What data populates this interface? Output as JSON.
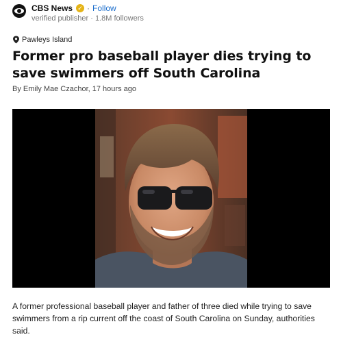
{
  "publisher": {
    "name": "CBS News",
    "verified_label": "verified publisher",
    "followers": "1.8M followers",
    "follow_label": "Follow",
    "logo_icon": "cbs-eye-icon",
    "verified_icon": "verified-check-icon"
  },
  "article": {
    "location": "Pawleys Island",
    "location_icon": "map-pin-icon",
    "headline": "Former pro baseball player dies trying to save swimmers off South Carolina",
    "byline": "By Emily Mae Czachor, 17 hours ago",
    "summary": "A former professional baseball player and father of three died while trying to save swimmers from a rip current off the coast of South Carolina on Sunday, authorities said."
  },
  "colors": {
    "link": "#1a6dcc",
    "verified_badge": "#e5b418",
    "image_bg": "#000000"
  }
}
